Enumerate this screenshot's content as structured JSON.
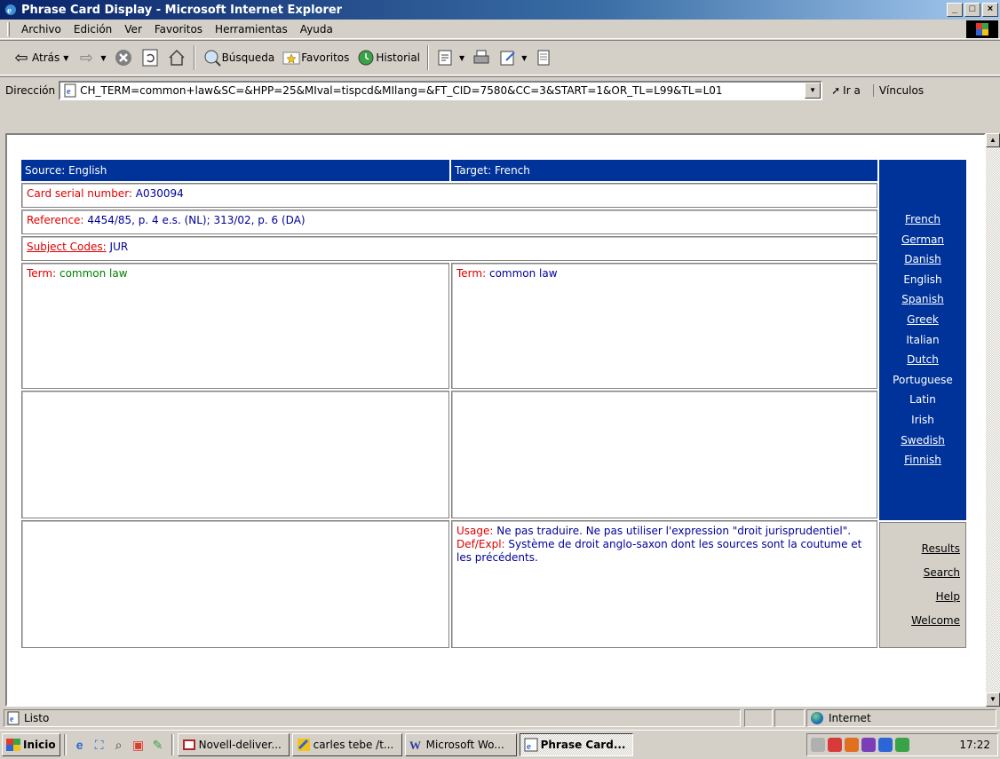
{
  "window": {
    "title": "Phrase Card Display - Microsoft Internet Explorer",
    "controls": [
      "_",
      "□",
      "×"
    ]
  },
  "menubar": [
    "Archivo",
    "Edición",
    "Ver",
    "Favoritos",
    "Herramientas",
    "Ayuda"
  ],
  "toolbar": {
    "back": "Atrás",
    "search": "Búsqueda",
    "favorites": "Favoritos",
    "history": "Historial"
  },
  "address": {
    "label": "Dirección",
    "url": "CH_TERM=common+law&SC=&HPP=25&MIval=tispcd&MIlang=&FT_CID=7580&CC=3&START=1&OR_TL=L99&TL=L01",
    "go": "Ir a",
    "links": "Vínculos"
  },
  "card": {
    "source": "Source: English",
    "target": "Target: French",
    "serial_label": "Card serial number:",
    "serial_value": "A030094",
    "ref_label": "Reference:",
    "ref_value": "4454/85, p. 4 e.s. (NL); 313/02, p. 6 (DA)",
    "subject_label": "Subject Codes:",
    "subject_value": "JUR",
    "term_label": "Term:",
    "source_term": "common law",
    "target_term": "common law",
    "usage_label": "Usage:",
    "usage_value": "Ne pas traduire. Ne pas utiliser l'expression \"droit jurisprudentiel\".",
    "def_label": "Def/Expl:",
    "def_value": "Système de droit anglo-saxon dont les sources sont la coutume et les précédents."
  },
  "languages": [
    {
      "name": "French",
      "link": true
    },
    {
      "name": "German",
      "link": true
    },
    {
      "name": "Danish",
      "link": true
    },
    {
      "name": "English",
      "link": false
    },
    {
      "name": "Spanish",
      "link": true
    },
    {
      "name": "Greek",
      "link": true
    },
    {
      "name": "Italian",
      "link": false
    },
    {
      "name": "Dutch",
      "link": true
    },
    {
      "name": "Portuguese",
      "link": false
    },
    {
      "name": "Latin",
      "link": false
    },
    {
      "name": "Irish",
      "link": false
    },
    {
      "name": "Swedish",
      "link": true
    },
    {
      "name": "Finnish",
      "link": true
    }
  ],
  "nav": [
    "Results",
    "Search",
    "Help",
    "Welcome"
  ],
  "status": {
    "text": "Listo",
    "zone": "Internet"
  },
  "taskbar": {
    "start": "Inicio",
    "tasks": [
      "Novell-deliver...",
      "carles tebe /t...",
      "Microsoft Wo...",
      "Phrase Card..."
    ],
    "clock": "17:22"
  },
  "colors": {
    "panel_blue": "#003399",
    "label_red": "#e00000",
    "value_blue": "#000099",
    "value_green": "#008000"
  }
}
